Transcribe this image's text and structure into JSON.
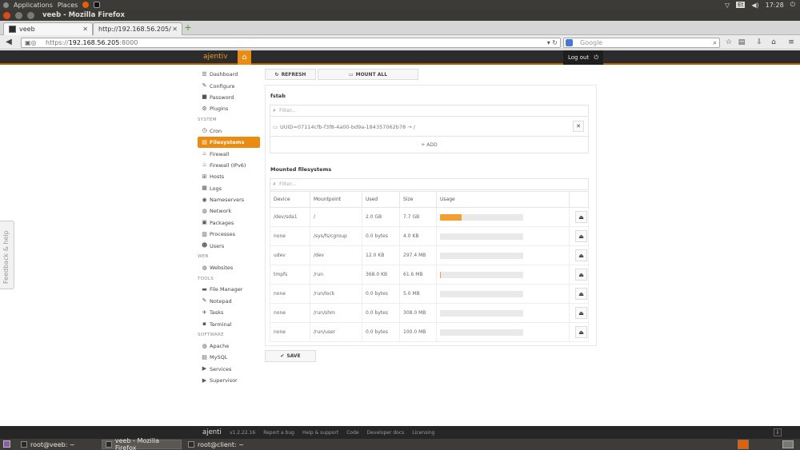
{
  "os": {
    "menu": [
      "Applications",
      "Places"
    ],
    "clock": "17:28",
    "kb_indicator": "Et"
  },
  "browser": {
    "window_title": "veeb - Mozilla Firefox",
    "tabs": [
      {
        "label": "veeb",
        "active": true
      },
      {
        "label": "http://192.168.56.205/",
        "active": false
      }
    ],
    "url_scheme": "https://",
    "url_host": "192.168.56.205",
    "url_port": ":8000",
    "search_placeholder": "Google"
  },
  "app": {
    "brand": "ajenti",
    "brand_mark": "v",
    "logout": "Log out",
    "feedback": "Feedback & help"
  },
  "sidebar": [
    {
      "type": "item",
      "label": "Dashboard",
      "icon": "☰"
    },
    {
      "type": "item",
      "label": "Configure",
      "icon": "✎"
    },
    {
      "type": "item",
      "label": "Password",
      "icon": "■"
    },
    {
      "type": "item",
      "label": "Plugins",
      "icon": "⚙"
    },
    {
      "type": "section",
      "label": "SYSTEM"
    },
    {
      "type": "item",
      "label": "Cron",
      "icon": "◷"
    },
    {
      "type": "item",
      "label": "Filesystems",
      "icon": "▤",
      "active": true
    },
    {
      "type": "item",
      "label": "Firewall",
      "icon": "♨"
    },
    {
      "type": "item",
      "label": "Firewall (IPv6)",
      "icon": "♨"
    },
    {
      "type": "item",
      "label": "Hosts",
      "icon": "⊞"
    },
    {
      "type": "item",
      "label": "Logs",
      "icon": "▦"
    },
    {
      "type": "item",
      "label": "Nameservers",
      "icon": "◉"
    },
    {
      "type": "item",
      "label": "Network",
      "icon": "◍"
    },
    {
      "type": "item",
      "label": "Packages",
      "icon": "▣"
    },
    {
      "type": "item",
      "label": "Processes",
      "icon": "▥"
    },
    {
      "type": "item",
      "label": "Users",
      "icon": "☻"
    },
    {
      "type": "section",
      "label": "WEB"
    },
    {
      "type": "item",
      "label": "Websites",
      "icon": "◍"
    },
    {
      "type": "section",
      "label": "TOOLS"
    },
    {
      "type": "item",
      "label": "File Manager",
      "icon": "▬"
    },
    {
      "type": "item",
      "label": "Notepad",
      "icon": "✎"
    },
    {
      "type": "item",
      "label": "Tasks",
      "icon": "✈"
    },
    {
      "type": "item",
      "label": "Terminal",
      "icon": "▪"
    },
    {
      "type": "section",
      "label": "SOFTWARE"
    },
    {
      "type": "item",
      "label": "Apache",
      "icon": "◍"
    },
    {
      "type": "item",
      "label": "MySQL",
      "icon": "▤"
    },
    {
      "type": "item",
      "label": "Services",
      "icon": "▶"
    },
    {
      "type": "item",
      "label": "Supervisor",
      "icon": "▶"
    }
  ],
  "toolbar": {
    "refresh": "REFRESH",
    "mount_all": "MOUNT ALL"
  },
  "fstab": {
    "title": "fstab",
    "filter_placeholder": "Filter...",
    "entry": "UUID=07114cfb-f3f8-4a00-bd9a-184357062b78 → /",
    "add": "ADD"
  },
  "mounted": {
    "title": "Mounted filesystems",
    "filter_placeholder": "Filter...",
    "columns": [
      "Device",
      "Mountpoint",
      "Used",
      "Size",
      "Usage"
    ],
    "rows": [
      {
        "device": "/dev/sda1",
        "mountpoint": "/",
        "used": "2.0 GB",
        "size": "7.7 GB",
        "usage": 0.26
      },
      {
        "device": "none",
        "mountpoint": "/sys/fs/cgroup",
        "used": "0.0 bytes",
        "size": "4.0 KB",
        "usage": 0
      },
      {
        "device": "udev",
        "mountpoint": "/dev",
        "used": "12.0 KB",
        "size": "297.4 MB",
        "usage": 0
      },
      {
        "device": "tmpfs",
        "mountpoint": "/run",
        "used": "368.0 KB",
        "size": "61.6 MB",
        "usage": 0.006
      },
      {
        "device": "none",
        "mountpoint": "/run/lock",
        "used": "0.0 bytes",
        "size": "5.0 MB",
        "usage": 0
      },
      {
        "device": "none",
        "mountpoint": "/run/shm",
        "used": "0.0 bytes",
        "size": "308.0 MB",
        "usage": 0
      },
      {
        "device": "none",
        "mountpoint": "/run/user",
        "used": "0.0 bytes",
        "size": "100.0 MB",
        "usage": 0
      }
    ]
  },
  "save": "SAVE",
  "footer": {
    "brand": "ajenti",
    "links": [
      "v1.2.22.16",
      "Report a bug",
      "Help & support",
      "Code",
      "Developer docs",
      "Licensing"
    ]
  },
  "taskbar": [
    {
      "label": "root@veeb: ~",
      "active": false
    },
    {
      "label": "veeb - Mozilla Firefox",
      "active": true
    },
    {
      "label": "root@client: ~",
      "active": false
    }
  ]
}
